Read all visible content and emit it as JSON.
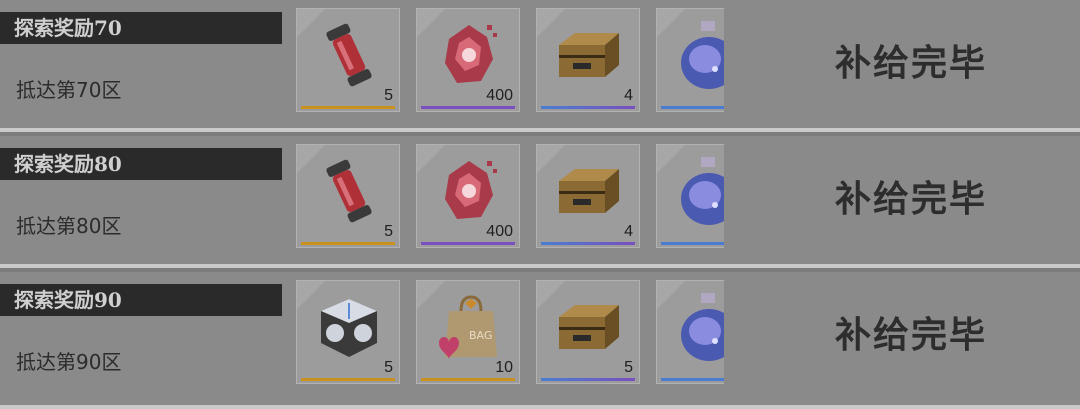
{
  "rows": [
    {
      "title": "探索奖励70",
      "subtitle": "抵达第70区",
      "status": "补给完毕",
      "items": [
        {
          "icon": "red-canister-icon",
          "count": "5",
          "rarity_color": "#c8901c"
        },
        {
          "icon": "red-crystal-icon",
          "count": "400",
          "rarity_color": "#7a4fc0"
        },
        {
          "icon": "supply-crate-icon",
          "count": "4",
          "rarity_color": "#4a7dd0"
        },
        {
          "icon": "galaxy-bottle-icon",
          "count": "",
          "rarity_color": "#4a7dd0"
        }
      ]
    },
    {
      "title": "探索奖励80",
      "subtitle": "抵达第80区",
      "status": "补给完毕",
      "items": [
        {
          "icon": "red-canister-icon",
          "count": "5",
          "rarity_color": "#c8901c"
        },
        {
          "icon": "red-crystal-icon",
          "count": "400",
          "rarity_color": "#7a4fc0"
        },
        {
          "icon": "supply-crate-icon",
          "count": "4",
          "rarity_color": "#4a7dd0"
        },
        {
          "icon": "galaxy-bottle-icon",
          "count": "",
          "rarity_color": "#4a7dd0"
        }
      ]
    },
    {
      "title": "探索奖励90",
      "subtitle": "抵达第90区",
      "status": "补给完毕",
      "items": [
        {
          "icon": "silver-cube-icon",
          "count": "5",
          "rarity_color": "#c8901c"
        },
        {
          "icon": "gift-bag-icon",
          "count": "10",
          "rarity_color": "#c8901c"
        },
        {
          "icon": "supply-crate-icon",
          "count": "5",
          "rarity_color": "#4a7dd0"
        },
        {
          "icon": "galaxy-bottle-icon",
          "count": "",
          "rarity_color": "#4a7dd0"
        }
      ]
    }
  ]
}
